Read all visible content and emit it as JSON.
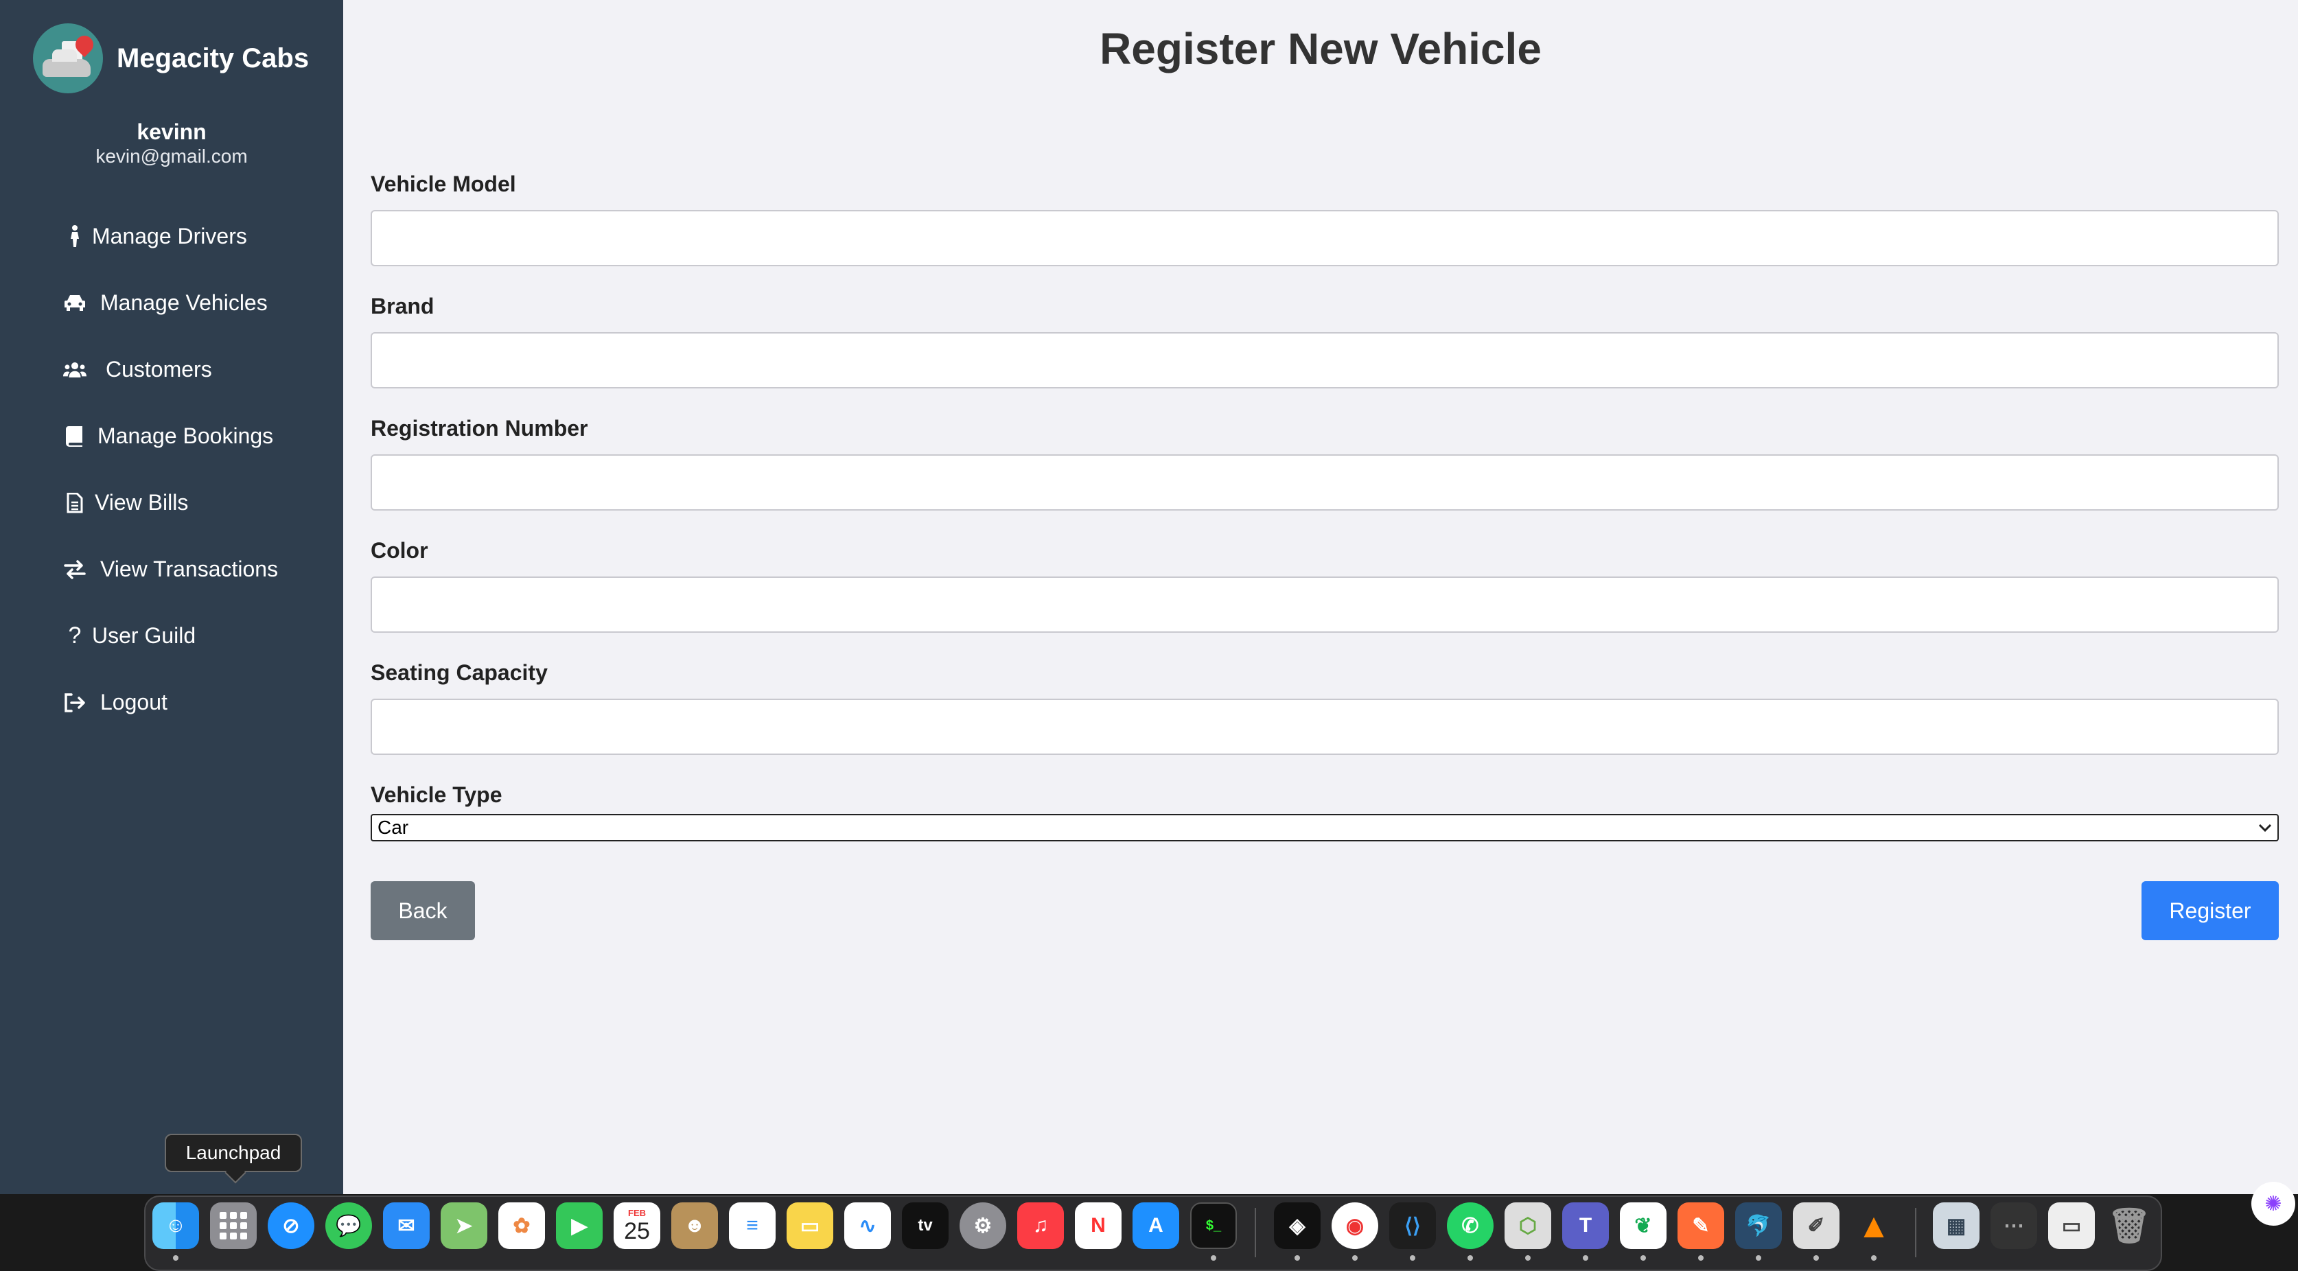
{
  "app": {
    "brand_name": "Megacity Cabs",
    "user": {
      "name": "kevinn",
      "email": "kevin@gmail.com"
    }
  },
  "sidebar": {
    "items": [
      {
        "label": "Manage Drivers",
        "icon": "person-walking-icon"
      },
      {
        "label": "Manage Vehicles",
        "icon": "car-icon"
      },
      {
        "label": "Customers",
        "icon": "users-icon"
      },
      {
        "label": "Manage Bookings",
        "icon": "book-icon"
      },
      {
        "label": "View Bills",
        "icon": "file-icon"
      },
      {
        "label": "View Transactions",
        "icon": "exchange-icon"
      },
      {
        "label": "User Guild",
        "icon": "question-icon"
      },
      {
        "label": "Logout",
        "icon": "logout-icon"
      }
    ]
  },
  "form": {
    "title": "Register New Vehicle",
    "fields": {
      "vehicle_model": {
        "label": "Vehicle Model",
        "value": ""
      },
      "brand": {
        "label": "Brand",
        "value": ""
      },
      "registration_number": {
        "label": "Registration Number",
        "value": ""
      },
      "color": {
        "label": "Color",
        "value": ""
      },
      "seating_capacity": {
        "label": "Seating Capacity",
        "value": ""
      },
      "vehicle_type": {
        "label": "Vehicle Type",
        "selected": "Car"
      }
    },
    "back_label": "Back",
    "register_label": "Register"
  },
  "tooltip": {
    "text": "Launchpad"
  },
  "dock": {
    "calendar": {
      "month": "FEB",
      "day": "25"
    },
    "apps": [
      "Finder",
      "Launchpad",
      "Safari",
      "Messages",
      "Mail",
      "Maps",
      "Photos",
      "FaceTime",
      "Calendar",
      "Contacts",
      "Reminders",
      "Notes",
      "Freeform",
      "TV",
      "Settings",
      "Music",
      "News",
      "App Store",
      "Terminal",
      "Unity Hub",
      "Chrome",
      "VS Code",
      "WhatsApp",
      "Cube App",
      "Teams",
      "MongoDB Compass",
      "Postman",
      "MySQL Workbench",
      "Script Editor",
      "VLC",
      "Preview",
      "Screenshot",
      "Window",
      "Trash"
    ]
  },
  "colors": {
    "sidebar": "#2f3e4e",
    "page_bg": "#f2f2f6",
    "primary": "#2d7ff9",
    "secondary": "#6c757d"
  }
}
